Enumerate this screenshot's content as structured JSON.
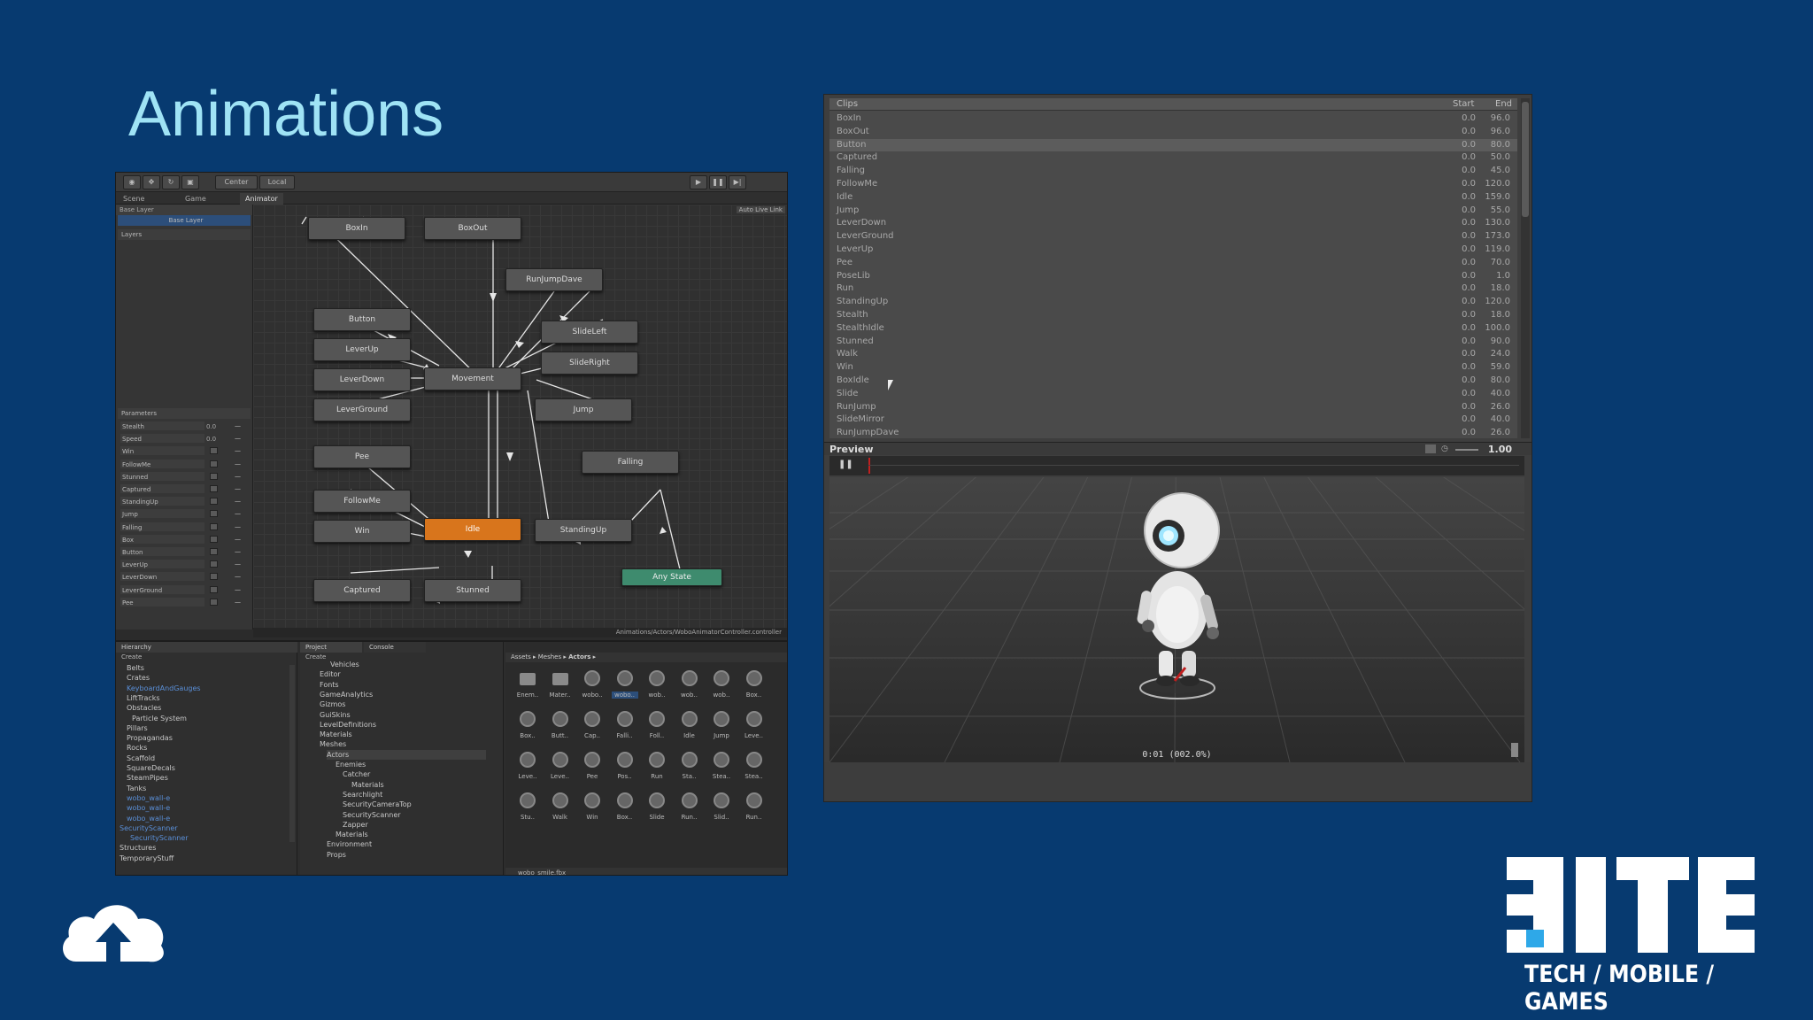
{
  "slide": {
    "title": "Animations",
    "logo_tag": "TECH / MOBILE / GAMES"
  },
  "editor": {
    "toolbar": {
      "center": "Center",
      "local": "Local"
    },
    "tabs": [
      "Scene",
      "Game",
      "Animator"
    ],
    "base_layer_label": "Base Layer",
    "auto_live_link": "Auto Live Link",
    "layers_header": "Layers",
    "base_layer_row": "Base Layer",
    "parameters_header": "Parameters",
    "parameters": [
      {
        "name": "Stealth",
        "value": "0.0"
      },
      {
        "name": "Speed",
        "value": "0.0"
      },
      {
        "name": "Win",
        "value": ""
      },
      {
        "name": "FollowMe",
        "value": ""
      },
      {
        "name": "Stunned",
        "value": ""
      },
      {
        "name": "Captured",
        "value": ""
      },
      {
        "name": "StandingUp",
        "value": ""
      },
      {
        "name": "Jump",
        "value": ""
      },
      {
        "name": "Falling",
        "value": ""
      },
      {
        "name": "Box",
        "value": ""
      },
      {
        "name": "Button",
        "value": ""
      },
      {
        "name": "LeverUp",
        "value": ""
      },
      {
        "name": "LeverDown",
        "value": ""
      },
      {
        "name": "LeverGround",
        "value": ""
      },
      {
        "name": "Pee",
        "value": ""
      }
    ],
    "states": {
      "boxin": "BoxIn",
      "boxout": "BoxOut",
      "runjumpdave": "RunJumpDave",
      "button": "Button",
      "slideleft": "SlideLeft",
      "leverup": "LeverUp",
      "movement": "Movement",
      "slideright": "SlideRight",
      "leverdown": "LeverDown",
      "leverground": "LeverGround",
      "jump": "Jump",
      "pee": "Pee",
      "falling": "Falling",
      "followme": "FollowMe",
      "idle": "Idle",
      "standingup": "StandingUp",
      "win": "Win",
      "anystate": "Any State",
      "captured": "Captured",
      "stunned": "Stunned"
    },
    "status_path": "Animations/Actors/WoboAnimatorController.controller",
    "hierarchy": {
      "tab": "Hierarchy",
      "create": "Create",
      "items": [
        {
          "label": "Belts",
          "blue": false
        },
        {
          "label": "Crates",
          "blue": false
        },
        {
          "label": "KeyboardAndGauges",
          "blue": true
        },
        {
          "label": "LiftTracks",
          "blue": false
        },
        {
          "label": "Obstacles",
          "blue": false
        },
        {
          "label": "Particle System",
          "blue": false
        },
        {
          "label": "Pillars",
          "blue": false
        },
        {
          "label": "Propagandas",
          "blue": false
        },
        {
          "label": "Rocks",
          "blue": false
        },
        {
          "label": "Scaffold",
          "blue": false
        },
        {
          "label": "SquareDecals",
          "blue": false
        },
        {
          "label": "SteamPipes",
          "blue": false
        },
        {
          "label": "Tanks",
          "blue": false
        },
        {
          "label": "wobo_wall-e",
          "blue": true
        },
        {
          "label": "wobo_wall-e",
          "blue": true
        },
        {
          "label": "wobo_wall-e",
          "blue": true
        },
        {
          "label": "SecurityScanner",
          "blue": true
        },
        {
          "label": "SecurityScanner",
          "blue": true
        },
        {
          "label": "Structures",
          "blue": false
        },
        {
          "label": "TemporaryStuff",
          "blue": false
        }
      ]
    },
    "project": {
      "tab": "Project",
      "console_tab": "Console",
      "create": "Create",
      "folders": [
        "Vehicles",
        "Editor",
        "Fonts",
        "GameAnalytics",
        "Gizmos",
        "GuiSkins",
        "LevelDefinitions",
        "Materials",
        "Meshes",
        "Actors",
        "Enemies",
        "Catcher",
        "Materials",
        "Searchlight",
        "SecurityCameraTop",
        "SecurityScanner",
        "Zapper",
        "Materials",
        "Environment",
        "Props"
      ]
    },
    "assets": {
      "breadcrumb": [
        "Assets",
        "Meshes",
        "Actors"
      ],
      "rows": [
        [
          "Enem..",
          "Mater..",
          "wobo..",
          "wobo..",
          "wob..",
          "wob..",
          "wob..",
          "Box.."
        ],
        [
          "Box..",
          "Butt..",
          "Cap..",
          "Falli..",
          "Foll..",
          "Idle",
          "Jump",
          "Leve.."
        ],
        [
          "Leve..",
          "Leve..",
          "Pee",
          "Pos..",
          "Run",
          "Sta..",
          "Stea..",
          "Stea.."
        ],
        [
          "Stu..",
          "Walk",
          "Win",
          "Box..",
          "Slide",
          "Run..",
          "Slid..",
          "Run.."
        ]
      ],
      "selected_file": "wobo_smile.fbx"
    }
  },
  "clips_panel": {
    "header": {
      "clips": "Clips",
      "start": "Start",
      "end": "End"
    },
    "rows": [
      {
        "name": "BoxIn",
        "start": "0.0",
        "end": "96.0"
      },
      {
        "name": "BoxOut",
        "start": "0.0",
        "end": "96.0"
      },
      {
        "name": "Button",
        "start": "0.0",
        "end": "80.0"
      },
      {
        "name": "Captured",
        "start": "0.0",
        "end": "50.0"
      },
      {
        "name": "Falling",
        "start": "0.0",
        "end": "45.0"
      },
      {
        "name": "FollowMe",
        "start": "0.0",
        "end": "120.0"
      },
      {
        "name": "Idle",
        "start": "0.0",
        "end": "159.0"
      },
      {
        "name": "Jump",
        "start": "0.0",
        "end": "55.0"
      },
      {
        "name": "LeverDown",
        "start": "0.0",
        "end": "130.0"
      },
      {
        "name": "LeverGround",
        "start": "0.0",
        "end": "173.0"
      },
      {
        "name": "LeverUp",
        "start": "0.0",
        "end": "119.0"
      },
      {
        "name": "Pee",
        "start": "0.0",
        "end": "70.0"
      },
      {
        "name": "PoseLib",
        "start": "0.0",
        "end": "1.0"
      },
      {
        "name": "Run",
        "start": "0.0",
        "end": "18.0"
      },
      {
        "name": "StandingUp",
        "start": "0.0",
        "end": "120.0"
      },
      {
        "name": "Stealth",
        "start": "0.0",
        "end": "18.0"
      },
      {
        "name": "StealthIdle",
        "start": "0.0",
        "end": "100.0"
      },
      {
        "name": "Stunned",
        "start": "0.0",
        "end": "90.0"
      },
      {
        "name": "Walk",
        "start": "0.0",
        "end": "24.0"
      },
      {
        "name": "Win",
        "start": "0.0",
        "end": "59.0"
      },
      {
        "name": "BoxIdle",
        "start": "0.0",
        "end": "80.0"
      },
      {
        "name": "Slide",
        "start": "0.0",
        "end": "40.0"
      },
      {
        "name": "RunJump",
        "start": "0.0",
        "end": "26.0"
      },
      {
        "name": "SlideMirror",
        "start": "0.0",
        "end": "40.0"
      },
      {
        "name": "RunJumpDave",
        "start": "0.0",
        "end": "26.0"
      }
    ],
    "selected_index": 2
  },
  "preview": {
    "title": "Preview",
    "speed": "1.00",
    "time": "0:01 (002.0%)"
  }
}
